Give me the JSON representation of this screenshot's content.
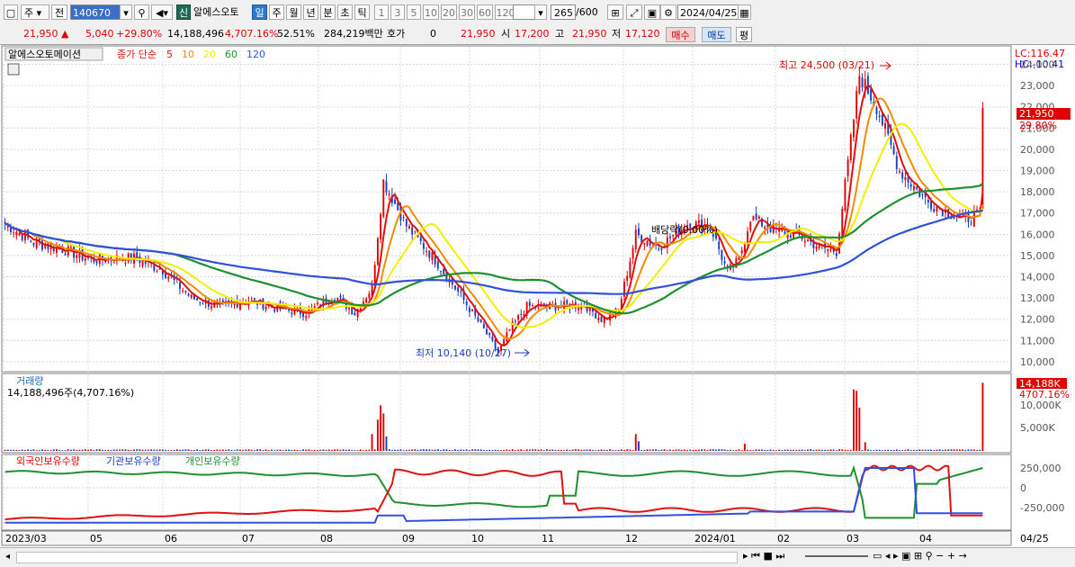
{
  "toolbar": {
    "type_label": "주",
    "prev_label": "전",
    "code": "140670",
    "new_label": "신",
    "stock_name": "알에스오토",
    "periods": [
      "일",
      "주",
      "월",
      "년",
      "분",
      "초",
      "틱"
    ],
    "intervals": [
      "1",
      "3",
      "5",
      "10",
      "20",
      "30",
      "60",
      "120"
    ],
    "count_value": "265",
    "count_total": "600",
    "date": "2024/04/25"
  },
  "quote": {
    "price": "21,950",
    "change": "5,040",
    "change_pct": "+29.80%",
    "volume": "14,188,496",
    "vol_ratio": "4,707.16%",
    "ratio2": "52.51%",
    "amount": "284,219백만",
    "hoga_label": "호가",
    "hoga_val": "0",
    "hoga_price": "21,950",
    "open_label": "시",
    "open": "17,200",
    "high_label": "고",
    "high": "21,950",
    "low_label": "저",
    "low": "17,120",
    "buy_label": "매수",
    "sell_label": "매도",
    "avg_label": "평"
  },
  "price_panel": {
    "name": "알에스오토메이션",
    "ma_title": "종가 단순",
    "ma_list": [
      "5",
      "10",
      "20",
      "60",
      "120"
    ],
    "lc": "LC:116.47",
    "hc": "HC:-10.41",
    "max_label": "최고 24,500 (03/21)",
    "min_label": "최저 10,140 (10/27)",
    "dividend_label": "배당락(0.00%)",
    "last_price": "21,950",
    "last_pct": "29.80%",
    "y_ticks": [
      "24,000",
      "23,000",
      "22,000",
      "21,000",
      "20,000",
      "19,000",
      "18,000",
      "17,000",
      "16,000",
      "15,000",
      "14,000",
      "13,000",
      "12,000",
      "11,000",
      "10,000"
    ]
  },
  "volume_panel": {
    "title": "거래량",
    "value": "14,188,496주(4,707.16%)",
    "last": "14,188K",
    "last_pct": "4707.16%",
    "y_ticks": [
      "10,000K",
      "5,000K"
    ]
  },
  "holding_panel": {
    "foreign": "외국인보유수량",
    "inst": "기관보유수량",
    "indiv": "개인보유수량",
    "y_ticks": [
      "250,000",
      "0",
      "-250,000"
    ]
  },
  "x_axis": {
    "labels": [
      "2023/03",
      "05",
      "06",
      "07",
      "08",
      "09",
      "10",
      "11",
      "12",
      "2024/01",
      "02",
      "03",
      "04"
    ],
    "end_label": "04/25"
  },
  "colors": {
    "up": "#e00000",
    "down": "#1a3fbf",
    "ma5": "#e01010",
    "ma10": "#f08c00",
    "ma20": "#f0f000",
    "ma60": "#1e9030",
    "ma120": "#3050e0"
  },
  "chart_data": {
    "type": "candlestick",
    "ylim": [
      9700,
      24700
    ],
    "close_approx": [
      {
        "x": "2023/03",
        "y": 16500
      },
      {
        "x": "2023/04",
        "y": 15200
      },
      {
        "x": "2023/05",
        "y": 14900
      },
      {
        "x": "2023/06",
        "y": 14700
      },
      {
        "x": "2023/07",
        "y": 12800
      },
      {
        "x": "2023/08",
        "y": 12700
      },
      {
        "x": "2023/08/31",
        "y": 18500
      },
      {
        "x": "2023/09",
        "y": 15400
      },
      {
        "x": "2023/10",
        "y": 11700
      },
      {
        "x": "2023/10/27",
        "y": 10140
      },
      {
        "x": "2023/11",
        "y": 12600
      },
      {
        "x": "2023/12",
        "y": 12200
      },
      {
        "x": "2024/01",
        "y": 16200
      },
      {
        "x": "2024/02",
        "y": 14000
      },
      {
        "x": "2024/02/15",
        "y": 16800
      },
      {
        "x": "2024/03",
        "y": 15400
      },
      {
        "x": "2024/03/21",
        "y": 24500
      },
      {
        "x": "2024/04",
        "y": 18500
      },
      {
        "x": "2024/04/24",
        "y": 16910
      },
      {
        "x": "2024/04/25",
        "y": 21950
      }
    ]
  }
}
